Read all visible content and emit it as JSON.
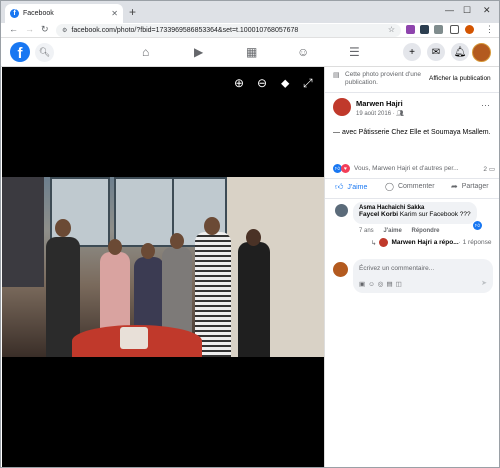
{
  "browser": {
    "tab_title": "Facebook",
    "url": "facebook.com/photo/?fbid=1733969586853364&set=t.100010768057678"
  },
  "post": {
    "notice": "Cette photo provient d'une publication.",
    "notice_link": "Afficher la publication",
    "author": "Marwen Hajri",
    "date": "19 août 2016 · ",
    "text": "— avec Pâtisserie Chez Elle et Soumaya Msallem.",
    "reactions_names": "Vous, Marwen Hajri et d'autres per...",
    "comment_count": "2",
    "actions": {
      "like": "J'aime",
      "comment": "Commenter",
      "share": "Partager"
    }
  },
  "comment": {
    "author": "Asma Hachaichi Sakka",
    "mention": "Faycel Korbi",
    "text": " Karim sur Facebook ???",
    "age": "7 ans",
    "like": "J'aime",
    "reply": "Répondre",
    "reply_summary_user": "Marwen Hajri a répo...",
    "reply_summary_count": " · 1 réponse"
  },
  "composer": {
    "placeholder": "Écrivez un commentaire..."
  },
  "colors": {
    "brand": "#1877f2",
    "heart": "#f33e58"
  }
}
